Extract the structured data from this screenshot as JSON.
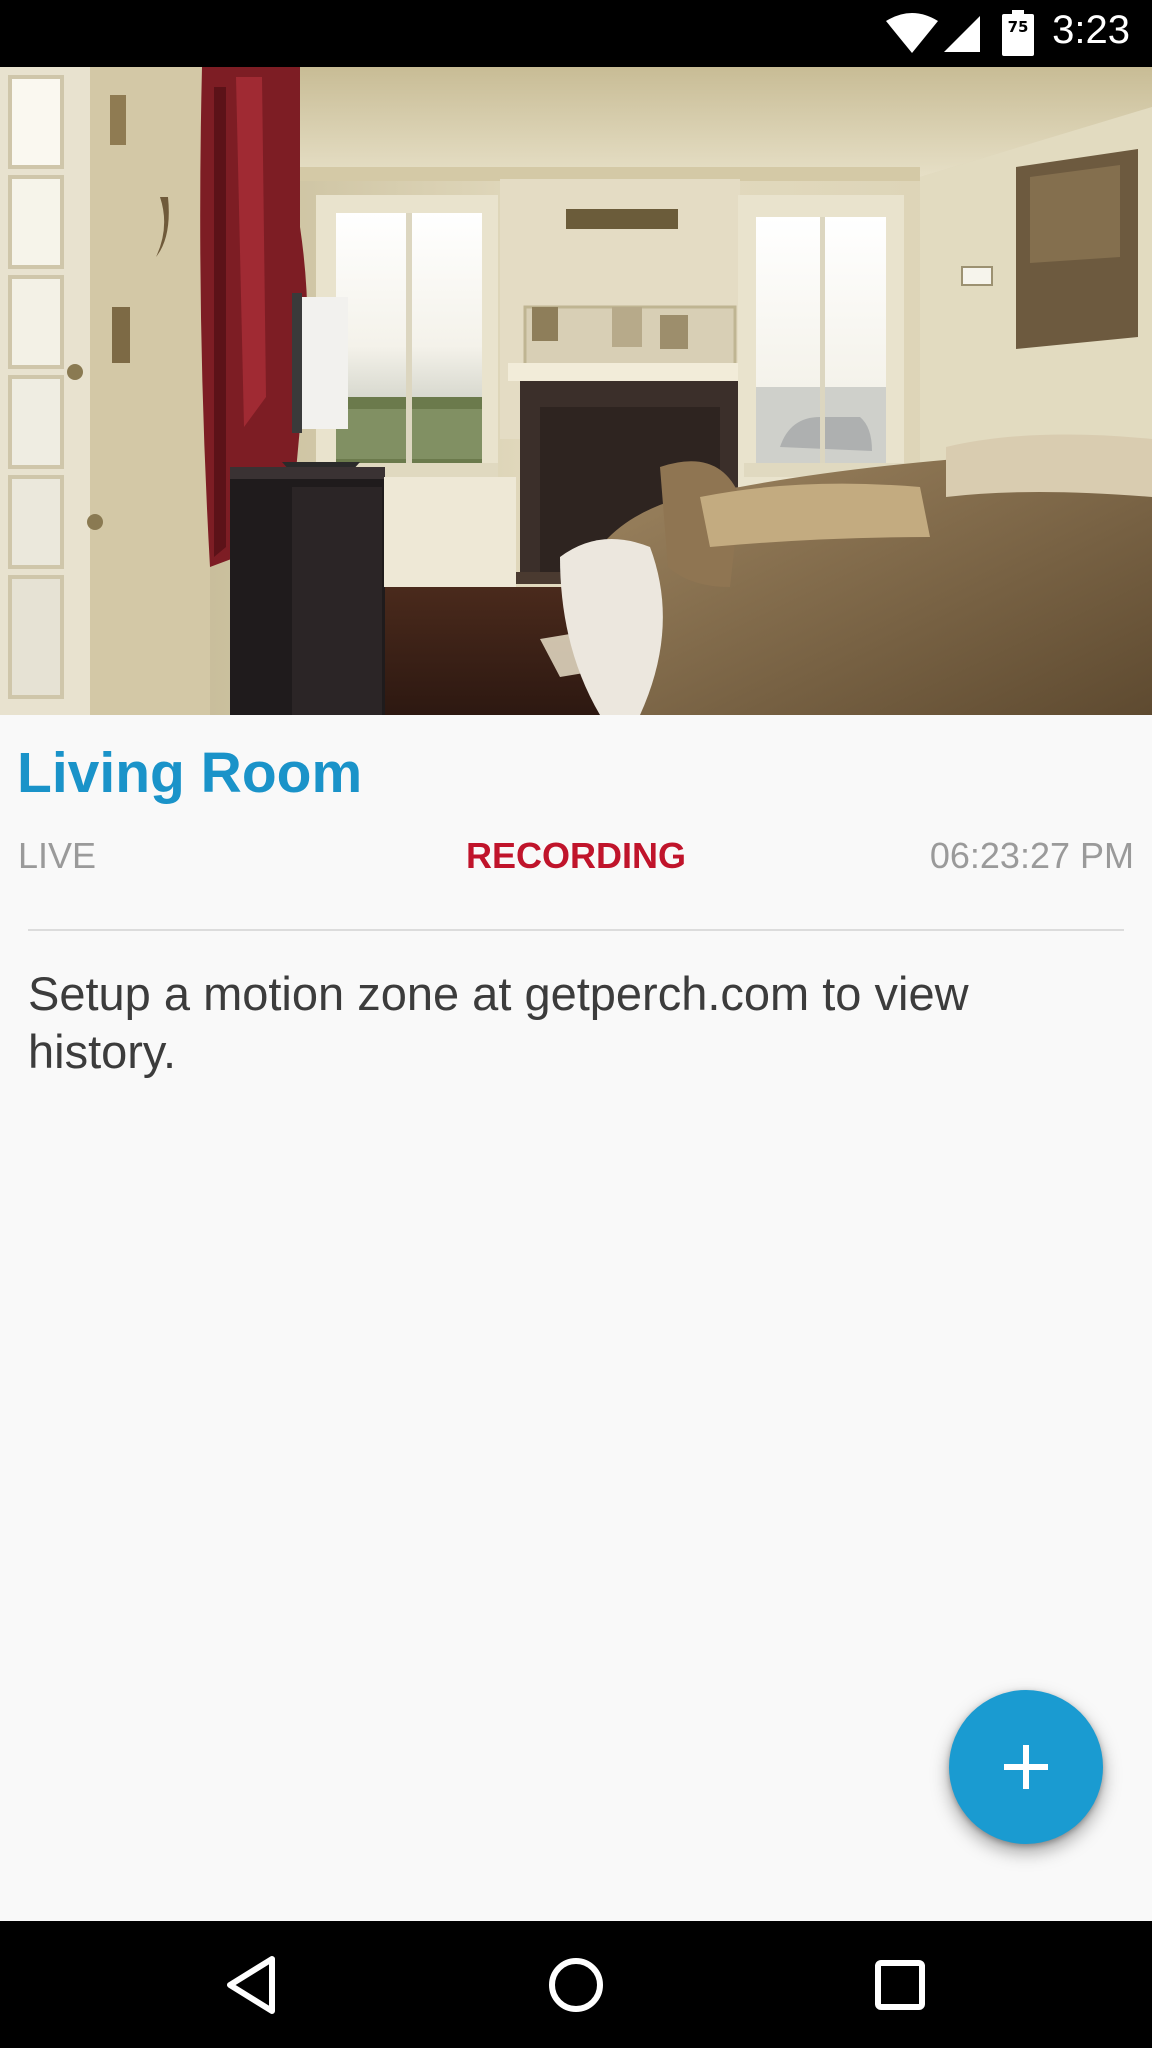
{
  "status_bar": {
    "time": "3:23",
    "battery_level": "75",
    "icons": [
      "wifi-icon",
      "signal-icon",
      "battery-icon"
    ]
  },
  "camera": {
    "name": "Living Room",
    "feed": "camera-feed-image",
    "status_live": "LIVE",
    "status_recording": "RECORDING",
    "timestamp": "06:23:27 PM"
  },
  "history": {
    "message": "Setup a motion zone at getperch.com to view history."
  },
  "fab": {
    "icon": "plus-icon"
  },
  "navigation": {
    "icons": [
      "back-triangle-icon",
      "home-circle-icon",
      "recents-square-icon"
    ]
  },
  "colors": {
    "title": "#1a93c9",
    "recording": "#c0142b",
    "muted": "#9a9a9a",
    "fab": "#1a9bd1",
    "background": "#f9f9f9",
    "system_bars": "#000000"
  }
}
